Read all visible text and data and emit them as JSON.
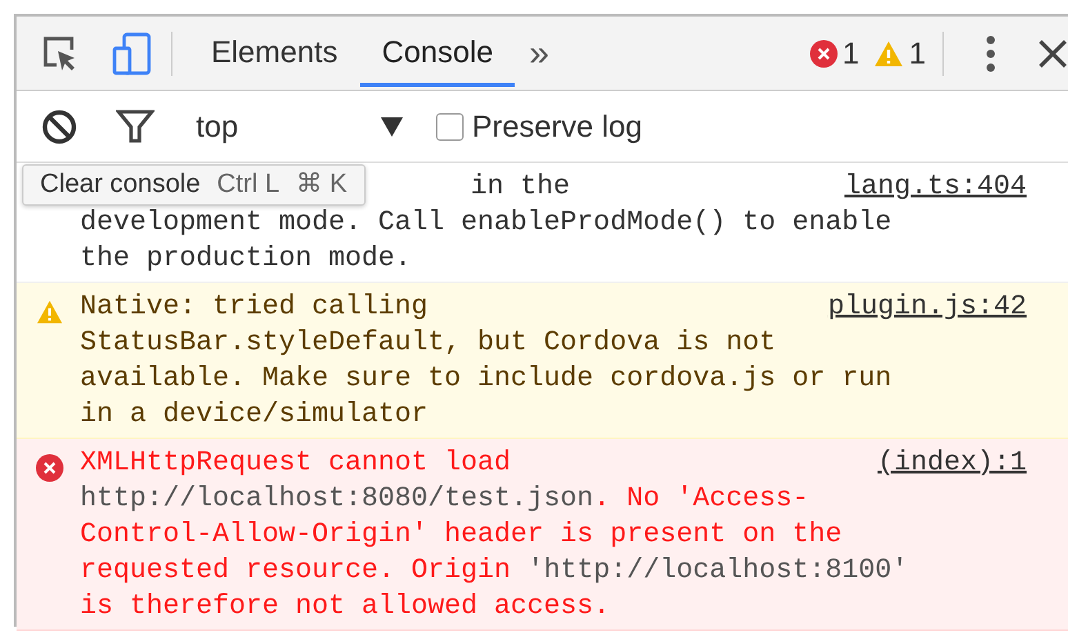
{
  "toolbar": {
    "tabs": [
      {
        "label": "Elements",
        "selected": false
      },
      {
        "label": "Console",
        "selected": true
      }
    ],
    "more": "»",
    "error_count": "1",
    "warning_count": "1"
  },
  "filter_bar": {
    "context": "top",
    "preserve_log": {
      "label": "Preserve log",
      "checked": false
    }
  },
  "tooltip": {
    "label": "Clear console",
    "shortcuts": [
      "Ctrl L",
      "⌘ K"
    ]
  },
  "messages": [
    {
      "kind": "log",
      "source": "lang.ts:404",
      "lines": [
        [
          {
            "kind": "text",
            "text": "in the"
          }
        ],
        [
          {
            "kind": "text",
            "text": "development mode. Call enableProdMode() to enable"
          }
        ],
        [
          {
            "kind": "text",
            "text": "the production mode."
          }
        ]
      ]
    },
    {
      "kind": "warning",
      "source": "plugin.js:42",
      "lines": [
        [
          {
            "kind": "text",
            "text": "Native: tried calling"
          }
        ],
        [
          {
            "kind": "text",
            "text": "StatusBar.styleDefault, but Cordova is not"
          }
        ],
        [
          {
            "kind": "text",
            "text": "available. Make sure to include cordova.js or run"
          }
        ],
        [
          {
            "kind": "text",
            "text": "in a device/simulator"
          }
        ]
      ]
    },
    {
      "kind": "error",
      "source": "(index):1",
      "lines": [
        [
          {
            "kind": "text",
            "text": "XMLHttpRequest cannot load"
          }
        ],
        [
          {
            "kind": "url",
            "text": "http://localhost:8080/test.json"
          },
          {
            "kind": "text",
            "text": ". No 'Access-"
          }
        ],
        [
          {
            "kind": "text",
            "text": "Control-Allow-Origin' header is present on the"
          }
        ],
        [
          {
            "kind": "text",
            "text": "requested resource. Origin "
          },
          {
            "kind": "url",
            "text": "'http://localhost:8100'"
          }
        ],
        [
          {
            "kind": "text",
            "text": "is therefore not allowed access."
          }
        ]
      ]
    }
  ]
}
